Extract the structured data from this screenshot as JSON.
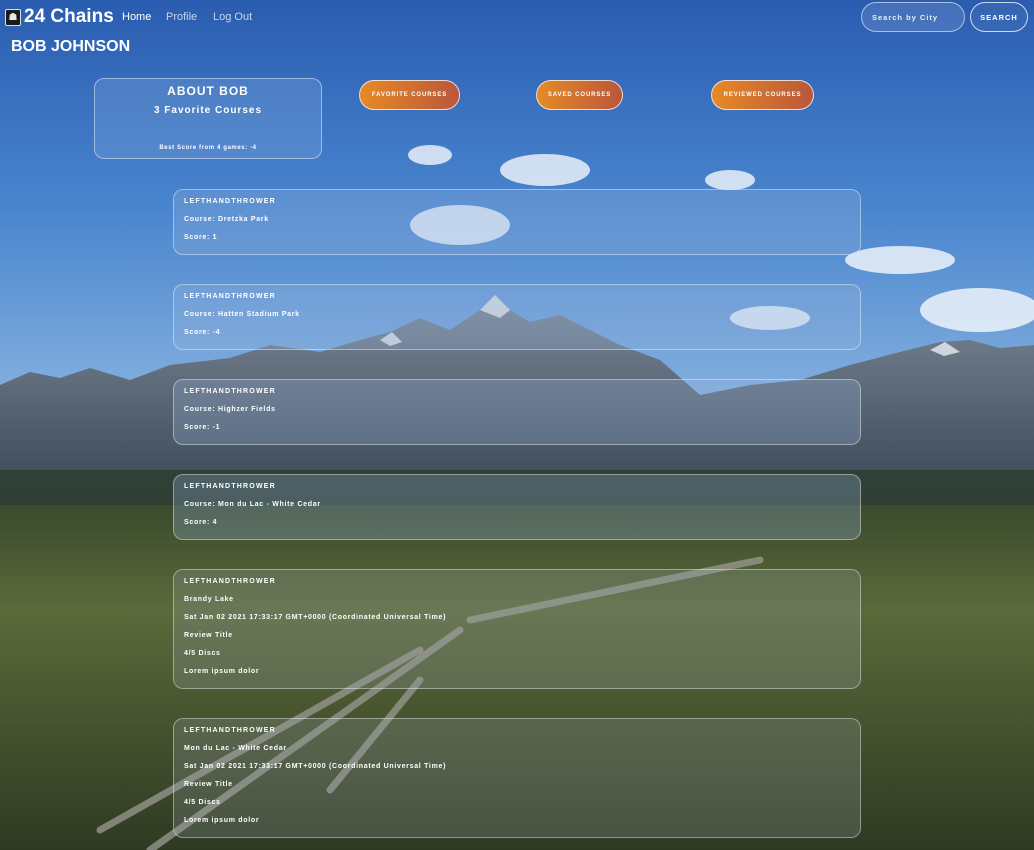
{
  "app": {
    "title": "24 Chains"
  },
  "nav": {
    "links": [
      "Home",
      "Profile",
      "Log Out"
    ]
  },
  "search": {
    "placeholder": "Search by City",
    "button_label": "SEARCH"
  },
  "profile": {
    "name": "BOB JOHNSON",
    "about_title": "ABOUT BOB",
    "favorites_text": "3 Favorite Courses",
    "best_score_text": "Best Score from 4 games: -4"
  },
  "tabs": [
    "FAVORITE COURSES",
    "SAVED COURSES",
    "REVIEWED COURSES"
  ],
  "scorecards": [
    {
      "user": "LEFTHANDTHROWER",
      "course": "Course: Dretzka Park",
      "score": "Score: 1"
    },
    {
      "user": "LEFTHANDTHROWER",
      "course": "Course: Hatten Stadium Park",
      "score": "Score: -4"
    },
    {
      "user": "LEFTHANDTHROWER",
      "course": "Course: Highzer Fields",
      "score": "Score: -1"
    },
    {
      "user": "LEFTHANDTHROWER",
      "course": "Course: Mon du Lac - White Cedar",
      "score": "Score: 4"
    }
  ],
  "reviews": [
    {
      "user": "LEFTHANDTHROWER",
      "course": "Brandy Lake",
      "date": "Sat Jan 02 2021 17:33:17 GMT+0000 (Coordinated Universal Time)",
      "title": "Review Title",
      "rating": "4/5 Discs",
      "body": "Lorem ipsum dolor"
    },
    {
      "user": "LEFTHANDTHROWER",
      "course": "Mon du Lac - White Cedar",
      "date": "Sat Jan 02 2021 17:33:17 GMT+0000 (Coordinated Universal Time)",
      "title": "Review Title",
      "rating": "4/5 Discs",
      "body": "Lorem ipsum dolor"
    }
  ],
  "colors": {
    "button_gradient_start": "#e68a25",
    "button_gradient_end": "#b9573c",
    "sky": "#2f63b4"
  }
}
